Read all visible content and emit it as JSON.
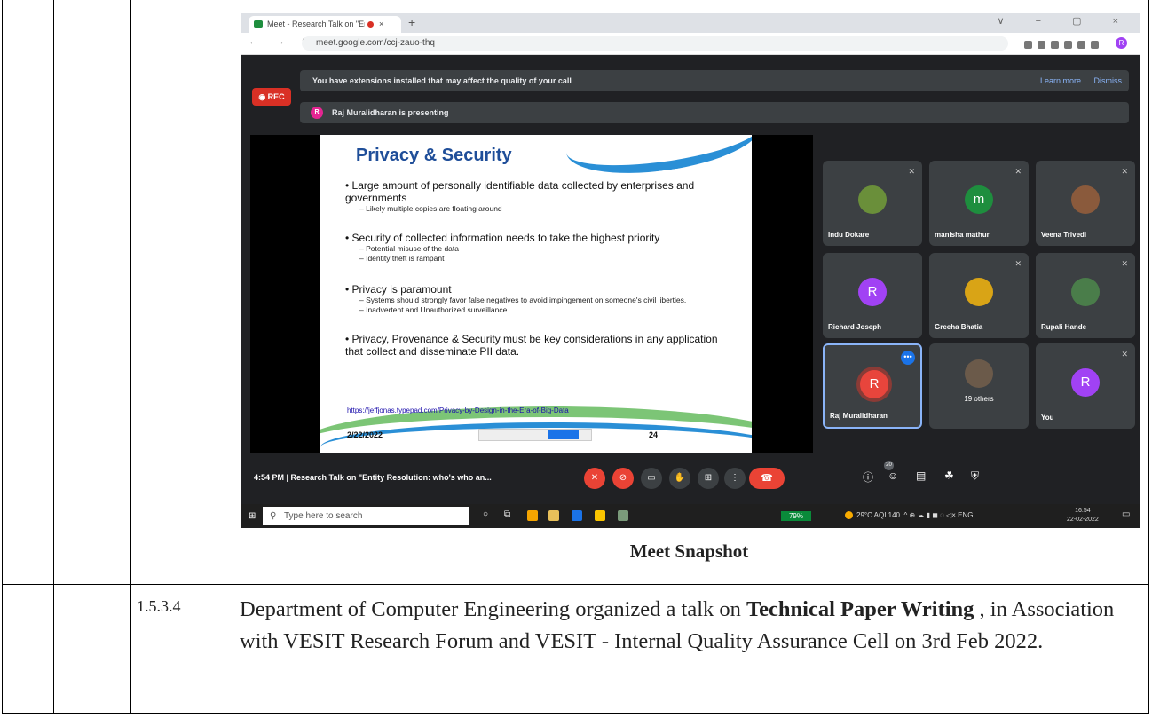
{
  "browser": {
    "tab_title": "Meet - Research Talk on \"Ent",
    "tab_close": "×",
    "new_tab": "+",
    "window_controls": "∨ − ▢ ×",
    "nav_icons": "← → C",
    "url": "meet.google.com/ccj-zauo-thq",
    "profile_initial": "R"
  },
  "meet": {
    "rec_label": "◉ REC",
    "banner_message": "You have extensions installed that may affect the quality of your call",
    "learn_more": "Learn more",
    "dismiss": "Dismiss",
    "presenter_initial": "R",
    "presenting_text": "Raj Muralidharan is presenting",
    "slide": {
      "title": "Privacy & Security",
      "bullets": [
        {
          "text": "• Large amount of personally identifiable data collected by enterprises and governments",
          "subs": [
            "– Likely multiple copies are floating around"
          ]
        },
        {
          "text": "• Security of collected information needs to take the highest priority",
          "subs": [
            "– Potential misuse of the data",
            "– Identity theft is rampant"
          ]
        },
        {
          "text": "• Privacy is paramount",
          "subs": [
            "– Systems should strongly favor false negatives to avoid impingement on someone's civil liberties.",
            "– Inadvertent and Unauthorized surveillance"
          ]
        },
        {
          "text": "• Privacy, Provenance & Security must be key considerations in any application that collect and disseminate PII data.",
          "subs": []
        }
      ],
      "link": "https://jeffjonas.typepad.com/Privacy-by-Design-in-the-Era-of-Big-Data",
      "date": "2/22/2022",
      "page": "24"
    },
    "participants": [
      {
        "name": "Indu Dokare",
        "initial": "",
        "color": "#6a8f3a"
      },
      {
        "name": "manisha mathur",
        "initial": "m",
        "color": "#1e8e3e"
      },
      {
        "name": "Veena Trivedi",
        "initial": "",
        "color": "#8a5a3c"
      },
      {
        "name": "Richard Joseph",
        "initial": "R",
        "color": "#a142f4"
      },
      {
        "name": "Greeha Bhatia",
        "initial": "",
        "color": "#d9a416"
      },
      {
        "name": "Rupali Hande",
        "initial": "",
        "color": "#4a7d4a"
      },
      {
        "name": "Raj Muralidharan",
        "initial": "R",
        "color": "#e8453c"
      },
      {
        "name": "19 others",
        "initial": "",
        "color": "#6b5a4a"
      },
      {
        "name": "You",
        "initial": "R",
        "color": "#a142f4"
      }
    ],
    "bottom_bar_text": "4:54 PM  |  Research Talk on \"Entity Resolution: who's who an...",
    "participant_count": "20"
  },
  "taskbar": {
    "search_placeholder": "Type here to search",
    "battery": "79%",
    "weather": "29°C  AQI 140",
    "tray": "^  ⊕  ☁  ▮  ◼  ◌  ◁×  ENG",
    "time": "16:54",
    "date": "22-02-2022"
  },
  "caption": "Meet Snapshot",
  "row2": {
    "number": "1.5.3.4",
    "text_a": "Department of Computer Engineering  organized a talk on ",
    "text_bold": "Technical Paper Writing",
    "text_b": " , in Association with  VESIT Research Forum  and VESIT - Internal Quality Assurance Cell on 3rd Feb 2022."
  }
}
